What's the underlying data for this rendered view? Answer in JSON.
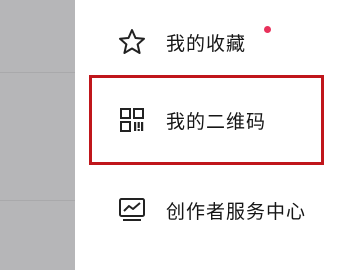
{
  "menu": {
    "items": [
      {
        "label": "我的收藏",
        "icon": "star-icon",
        "has_badge": true
      },
      {
        "label": "我的二维码",
        "icon": "qr-code-icon",
        "highlighted": true
      },
      {
        "label": "创作者服务中心",
        "icon": "creator-chart-icon"
      }
    ]
  },
  "colors": {
    "badge": "#e8315b",
    "highlight": "#c0161b",
    "backdrop": "#b6b6b8",
    "icon": "#222222"
  }
}
